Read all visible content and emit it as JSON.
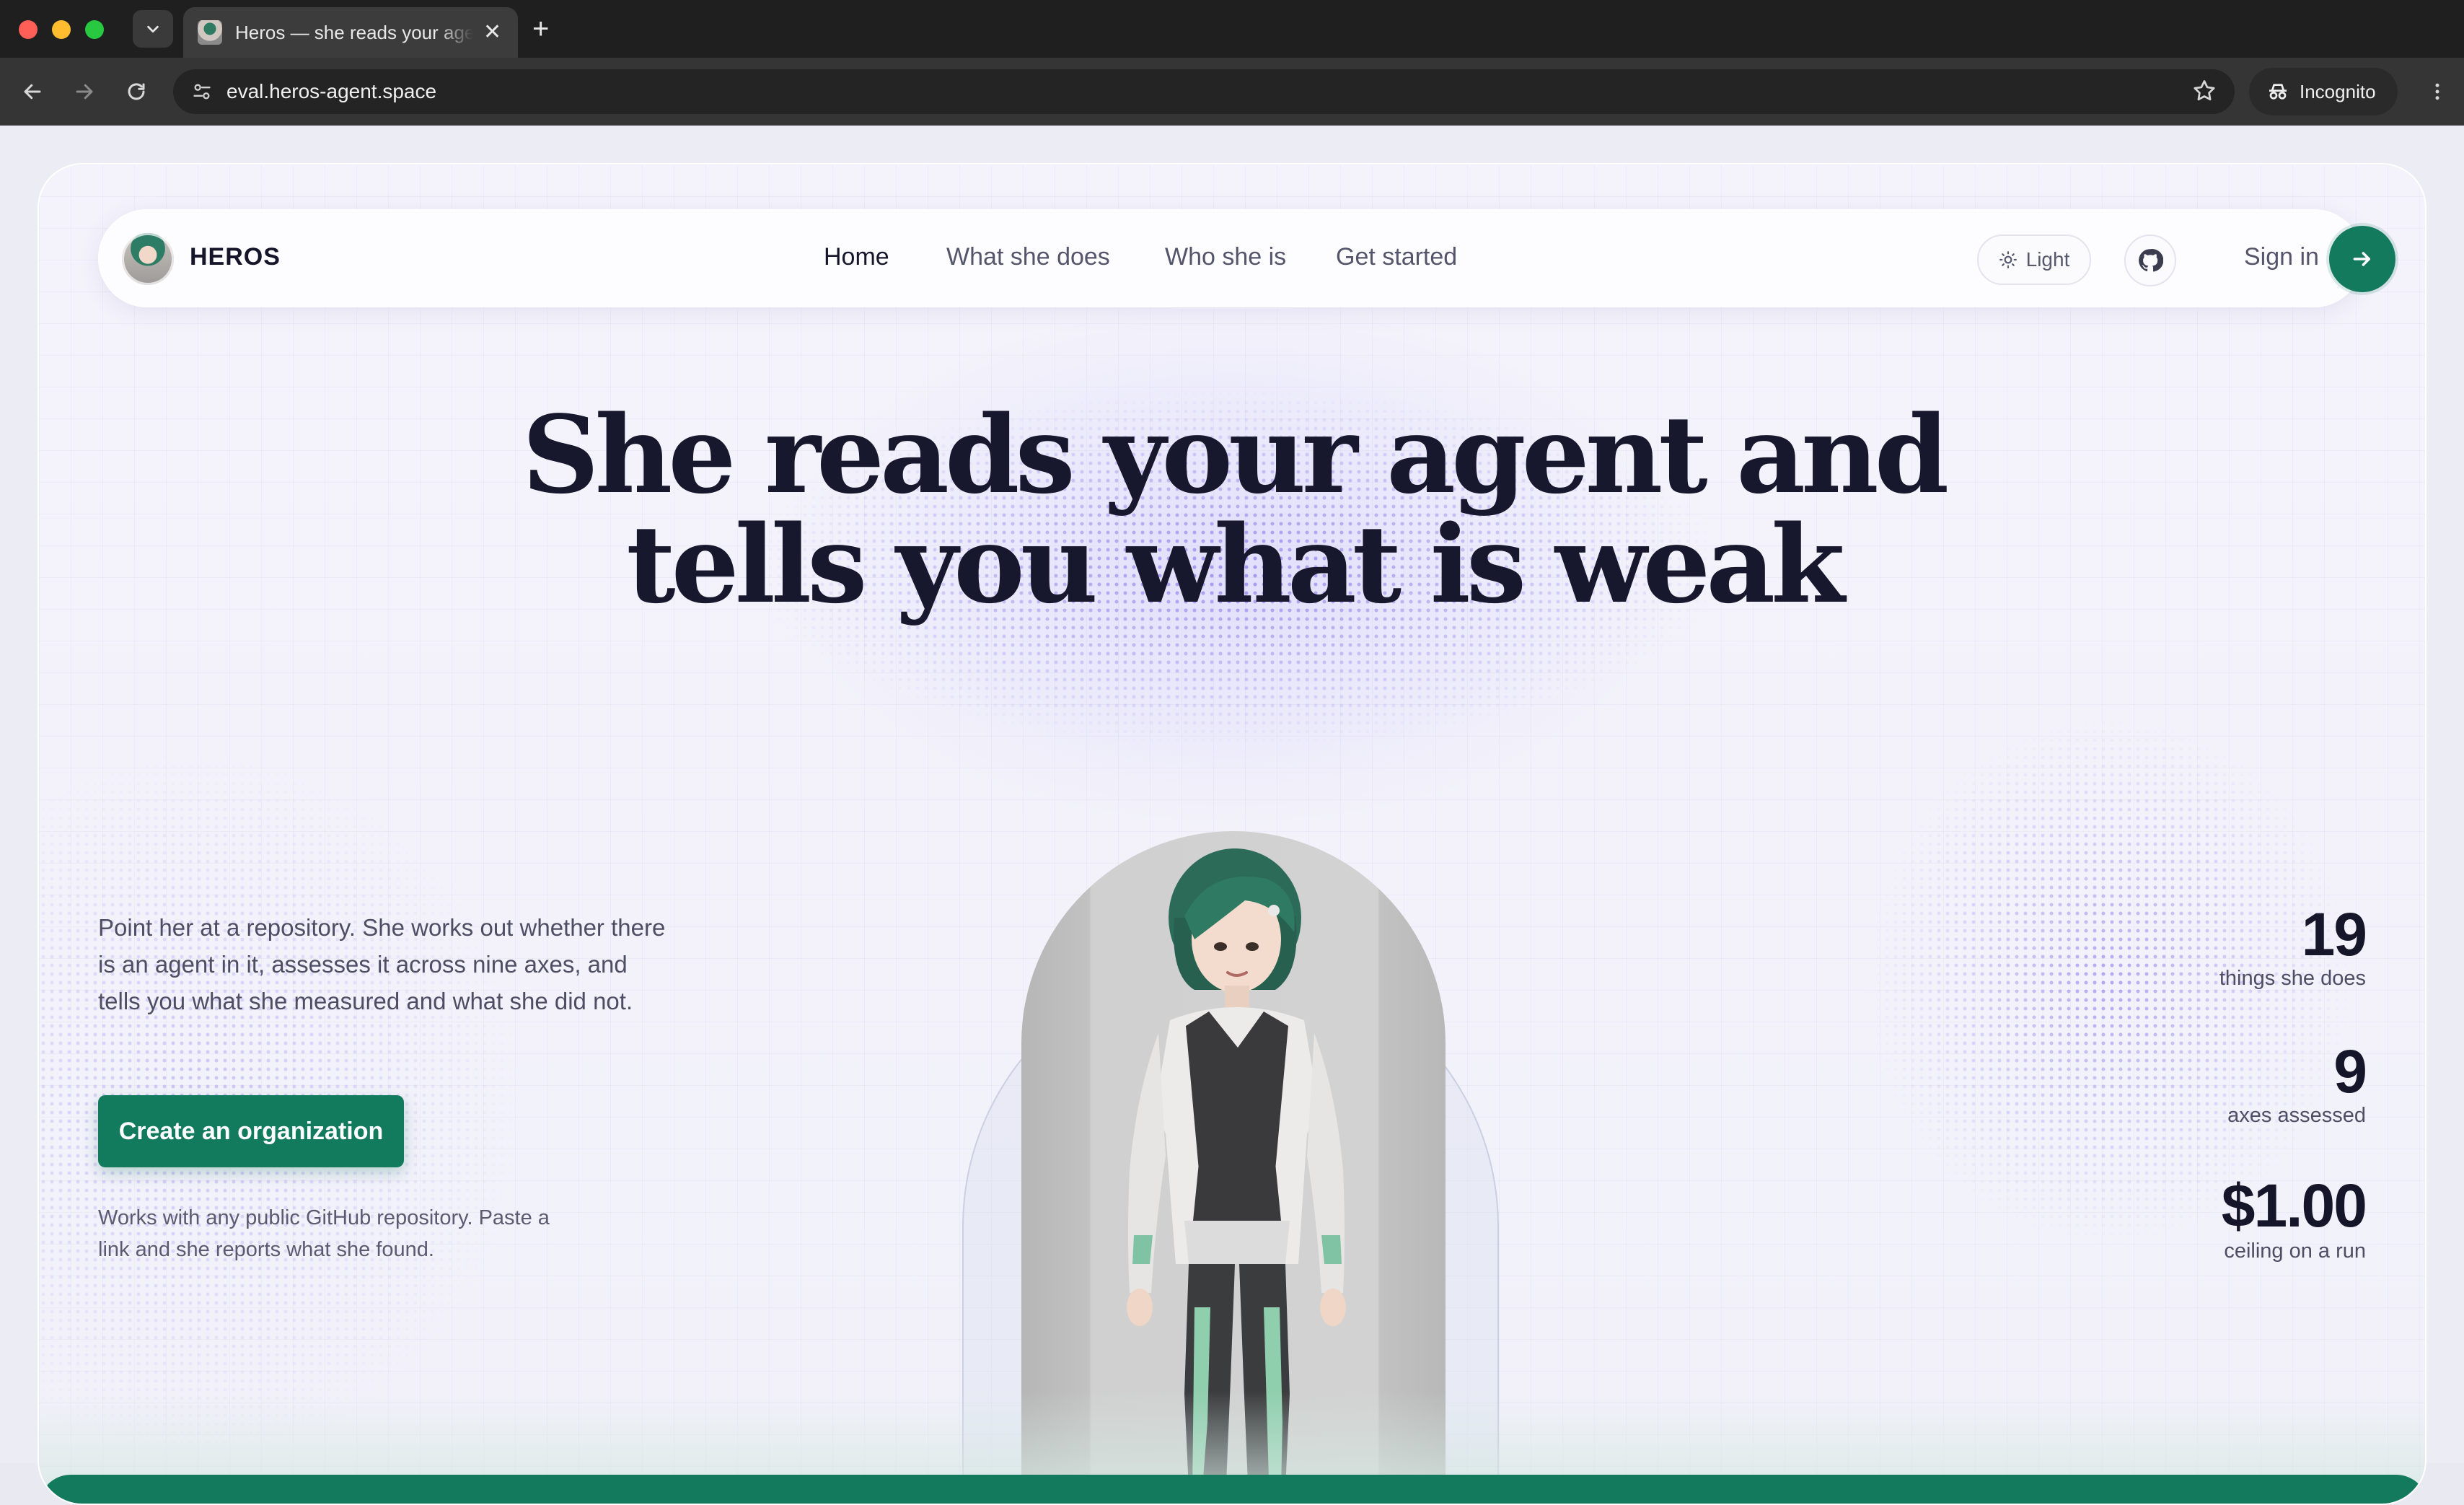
{
  "browser": {
    "tab_title": "Heros — she reads your agent and tells you what is weak",
    "url": "eval.heros-agent.space",
    "incognito_label": "Incognito"
  },
  "header": {
    "brand": "HEROS",
    "nav": [
      "Home",
      "What she does",
      "Who she is",
      "Get started"
    ],
    "active_nav": "Home",
    "theme_label": "Light",
    "signin_label": "Sign in"
  },
  "hero": {
    "headline_line1": "She reads your agent and",
    "headline_line2": "tells you what is weak",
    "intro": "Point her at a repository. She works out whether there is an agent in it, assesses it across nine axes, and tells you what she measured and what she did not.",
    "cta_label": "Create an organization",
    "note": "Works with any public GitHub repository. Paste a link and she reports what she found."
  },
  "stats": [
    {
      "value": "19",
      "label": "things she does"
    },
    {
      "value": "9",
      "label": "axes assessed"
    },
    {
      "value": "$1.00",
      "label": "ceiling on a run"
    }
  ],
  "colors": {
    "accent": "#137a5e",
    "text_dark": "#16162a",
    "text_muted": "#4d4d63",
    "dot_pattern": "#6e5ae6"
  },
  "icons": {
    "theme": "sun-icon",
    "repo": "github-icon",
    "signin": "arrow-right-icon"
  }
}
